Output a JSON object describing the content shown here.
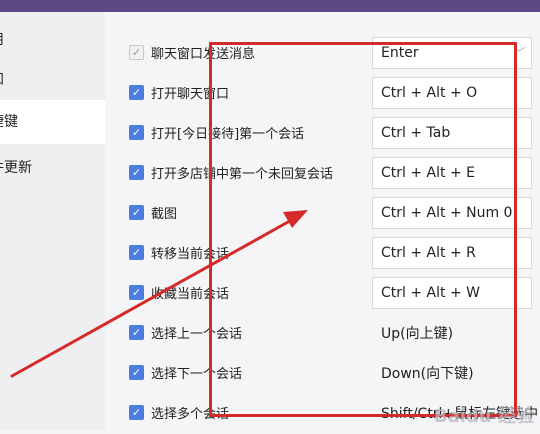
{
  "sidebar": {
    "items": [
      {
        "label": "用"
      },
      {
        "label": "知"
      },
      {
        "label": "捷键"
      },
      {
        "label": "件更新"
      }
    ]
  },
  "shortcuts": [
    {
      "label": "聊天窗口发送消息",
      "key": "Enter",
      "checked": true,
      "disabled": true,
      "dropdown": true
    },
    {
      "label": "打开聊天窗口",
      "key": "Ctrl + Alt + O",
      "checked": true
    },
    {
      "label": "打开[今日接待]第一个会话",
      "key": "Ctrl + Tab",
      "checked": true
    },
    {
      "label": "打开多店铺中第一个未回复会话",
      "key": "Ctrl + Alt + E",
      "checked": true
    },
    {
      "label": "截图",
      "key": "Ctrl + Alt + Num 0",
      "checked": true
    },
    {
      "label": "转移当前会话",
      "key": "Ctrl + Alt + R",
      "checked": true
    },
    {
      "label": "收藏当前会话",
      "key": "Ctrl + Alt + W",
      "checked": true
    },
    {
      "label": "选择上一个会话",
      "key": "Up(向上键)",
      "checked": true,
      "static": true
    },
    {
      "label": "选择下一个会话",
      "key": "Down(向下键)",
      "checked": true,
      "static": true
    },
    {
      "label": "选择多个会话",
      "key": "Shift/Ctrl+鼠标左键选中",
      "checked": true,
      "static": true
    }
  ],
  "icons": {
    "checkbox": "checkmark-icon",
    "dropdown": "chevron-down-icon",
    "annotation": "red-arrow-icon"
  },
  "colors": {
    "accent": "#4a7ee0",
    "annotation": "#d42a2a",
    "topbar": "#5b4a86"
  },
  "watermark": "Baidu 经验"
}
